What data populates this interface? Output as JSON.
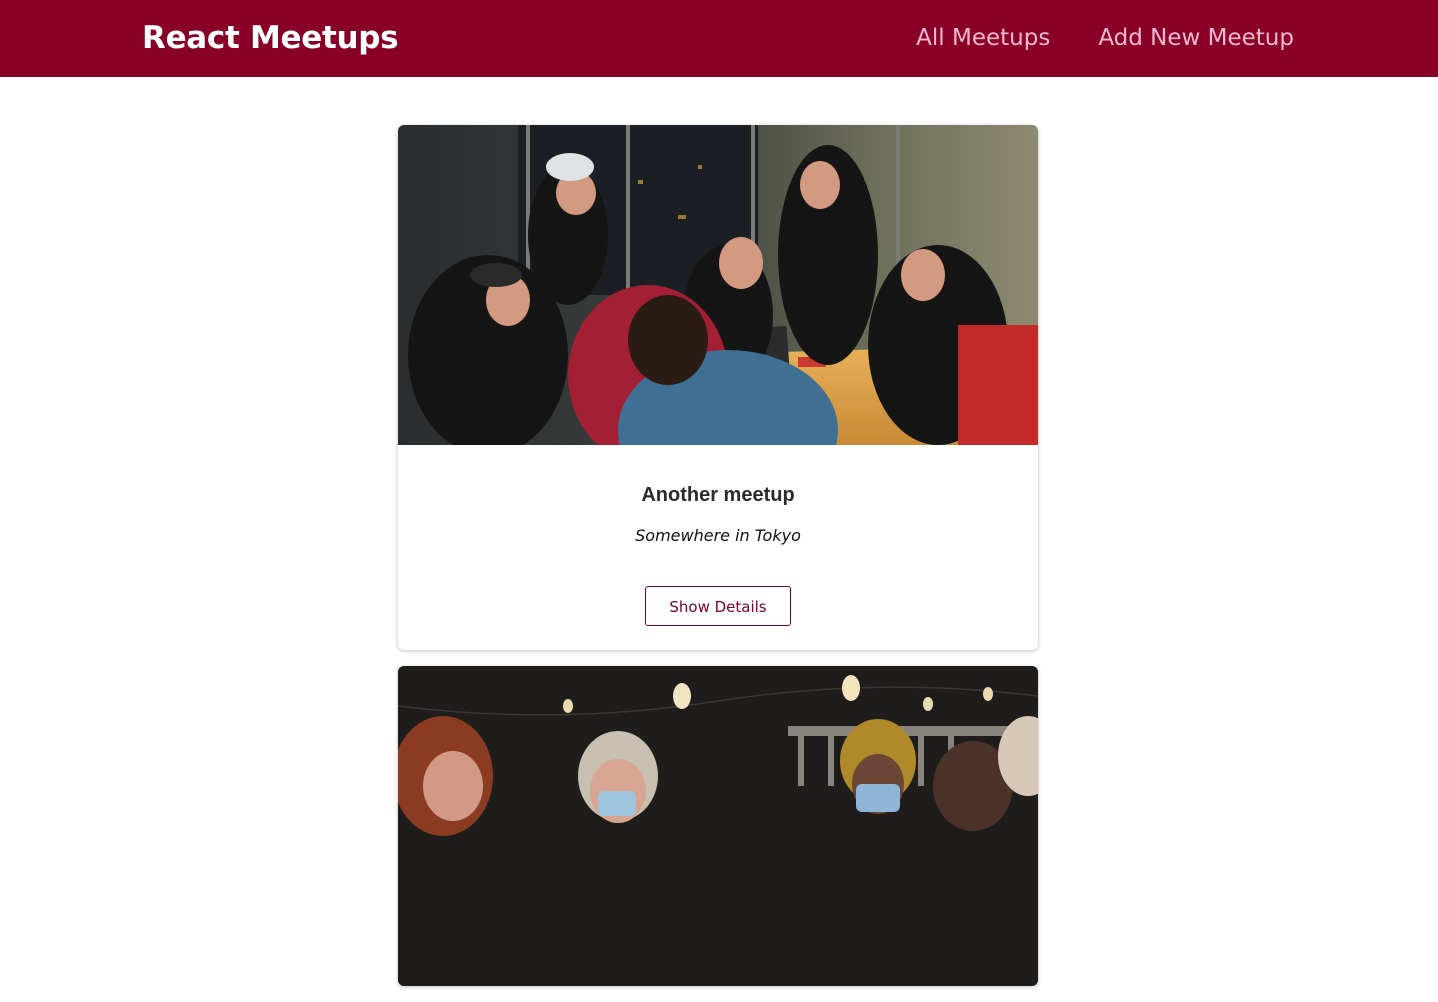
{
  "header": {
    "logo": "React Meetups",
    "nav": [
      {
        "label": "All Meetups"
      },
      {
        "label": "Add New Meetup"
      }
    ]
  },
  "meetups": [
    {
      "title": "Another meetup",
      "address": "Somewhere in Tokyo",
      "action_label": "Show Details"
    },
    {}
  ],
  "colors": {
    "header_bg": "#880026",
    "nav_link": "#fcb8d2",
    "accent": "#77002e"
  }
}
